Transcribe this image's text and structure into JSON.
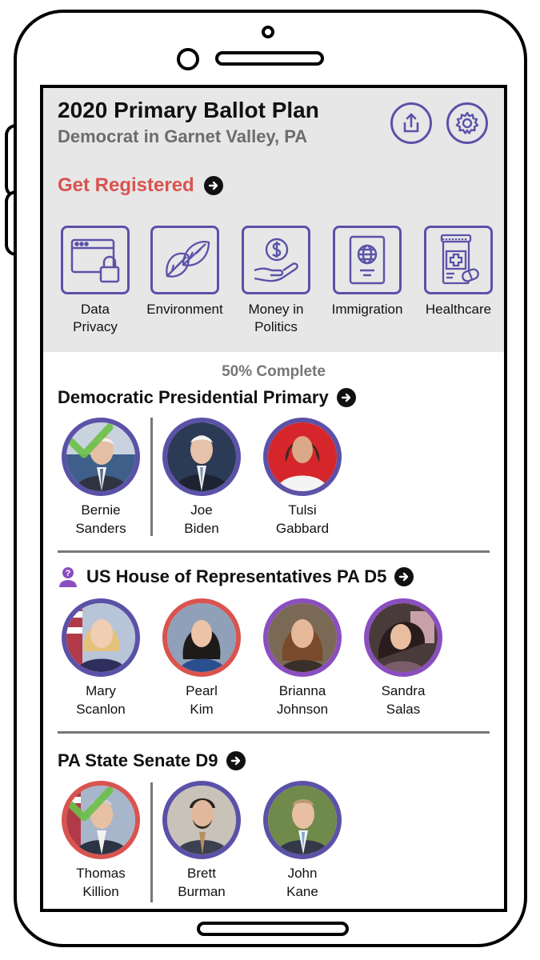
{
  "header": {
    "title": "2020 Primary Ballot Plan",
    "subtitle": "Democrat in Garnet Valley, PA",
    "register_label": "Get Registered"
  },
  "issues": [
    {
      "label": "Data Privacy",
      "icon": "data-privacy-icon"
    },
    {
      "label": "Environment",
      "icon": "leaf-icon"
    },
    {
      "label": "Money in Politics",
      "icon": "money-hand-icon"
    },
    {
      "label": "Immigration",
      "icon": "passport-icon"
    },
    {
      "label": "Healthcare",
      "icon": "medicine-icon"
    }
  ],
  "progress_label": "50% Complete",
  "races": [
    {
      "title": "Democratic Presidential Primary",
      "candidates": [
        {
          "name": "Bernie Sanders",
          "ring": "#5b52a8",
          "selected": true
        },
        {
          "name": "Joe Biden",
          "ring": "#5b52a8",
          "selected": false
        },
        {
          "name": "Tulsi Gabbard",
          "ring": "#5b52a8",
          "selected": false
        }
      ]
    },
    {
      "title": "US House of Representatives PA D5",
      "has_question_icon": true,
      "candidates": [
        {
          "name": "Mary Scanlon",
          "ring": "#5b52a8",
          "selected": false
        },
        {
          "name": "Pearl Kim",
          "ring": "#d9534f",
          "selected": false
        },
        {
          "name": "Brianna Johnson",
          "ring": "#8a4fbf",
          "selected": false
        },
        {
          "name": "Sandra Salas",
          "ring": "#8a4fbf",
          "selected": false
        }
      ]
    },
    {
      "title": "PA State Senate D9",
      "candidates": [
        {
          "name": "Thomas Killion",
          "ring": "#d9534f",
          "selected": true
        },
        {
          "name": "Brett Burman",
          "ring": "#5b52a8",
          "selected": false
        },
        {
          "name": "John Kane",
          "ring": "#5b52a8",
          "selected": false
        }
      ]
    }
  ],
  "colors": {
    "accent": "#5b52a8",
    "register": "#d9534f",
    "check": "#6cc04a",
    "header_bg": "#e7e7e7"
  }
}
